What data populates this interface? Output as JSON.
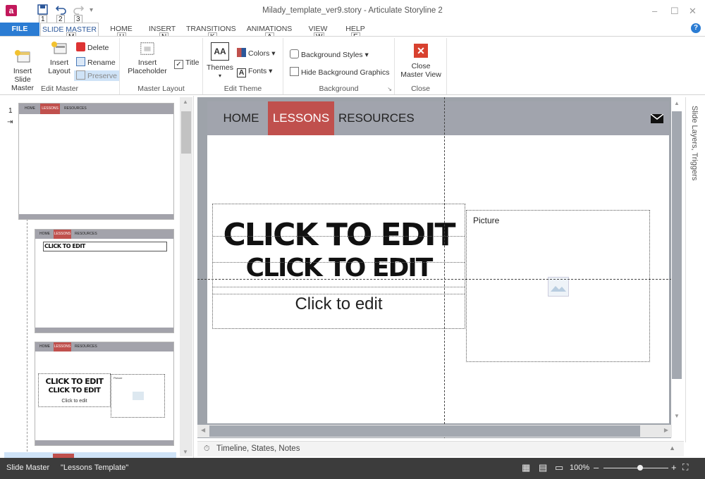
{
  "window": {
    "title": "Milady_template_ver9.story - Articulate Storyline 2",
    "app_icon": "a",
    "minimize": "–",
    "restore": "☐",
    "close": "✕"
  },
  "quick_access": {
    "keytips": [
      "1",
      "2",
      "3"
    ]
  },
  "tabs": [
    {
      "label": "FILE",
      "keytip": ""
    },
    {
      "label": "SLIDE MASTER",
      "keytip": "M"
    },
    {
      "label": "HOME",
      "keytip": "H"
    },
    {
      "label": "INSERT",
      "keytip": "N"
    },
    {
      "label": "TRANSITIONS",
      "keytip": "K"
    },
    {
      "label": "ANIMATIONS",
      "keytip": "A"
    },
    {
      "label": "VIEW",
      "keytip": "W"
    },
    {
      "label": "HELP",
      "keytip": "E"
    }
  ],
  "ribbon": {
    "edit_master": {
      "label": "Edit Master",
      "insert_slide_master": "Insert Slide\nMaster",
      "insert_layout": "Insert\nLayout",
      "delete": "Delete",
      "rename": "Rename",
      "preserve": "Preserve"
    },
    "master_layout": {
      "label": "Master Layout",
      "insert_placeholder": "Insert\nPlaceholder",
      "title_checkbox": "Title",
      "title_checked": true
    },
    "edit_theme": {
      "label": "Edit Theme",
      "themes": "Themes",
      "colors": "Colors",
      "fonts": "Fonts",
      "themes_icon_text": "AA",
      "fonts_icon_text": "A"
    },
    "background": {
      "label": "Background",
      "background_styles": "Background Styles",
      "hide_background_graphics": "Hide Background Graphics",
      "hide_checked": false
    },
    "close": {
      "label": "Close",
      "close_master_view": "Close\nMaster View"
    }
  },
  "thumbnails": {
    "slide_number": "1",
    "nav": [
      "HOME",
      "LESSONS",
      "RESOURCES"
    ],
    "layout2_title": "CLICK TO EDIT",
    "layout3_title1": "CLICK TO EDIT",
    "layout3_title2": "CLICK TO EDIT",
    "layout3_body": "Click to edit",
    "layout3_picture": "Picture"
  },
  "slide": {
    "nav": [
      "HOME",
      "LESSONS",
      "RESOURCES"
    ],
    "title_line1": "CLICK TO EDIT",
    "title_line2": "CLICK TO EDIT",
    "body": "Click to edit",
    "picture_label": "Picture"
  },
  "right_pane": {
    "label": "Slide Layers, Triggers"
  },
  "timeline": {
    "label": "Timeline, States, Notes"
  },
  "status": {
    "mode": "Slide Master",
    "layout_name": "\"Lessons Template\"",
    "zoom": "100%",
    "zoom_fraction": 0.57
  },
  "colors": {
    "accent_blue": "#2b7cd3",
    "lessons_red": "#c0504d",
    "nav_gray": "#a1a4ad",
    "status_bg": "#3c3c3c"
  }
}
